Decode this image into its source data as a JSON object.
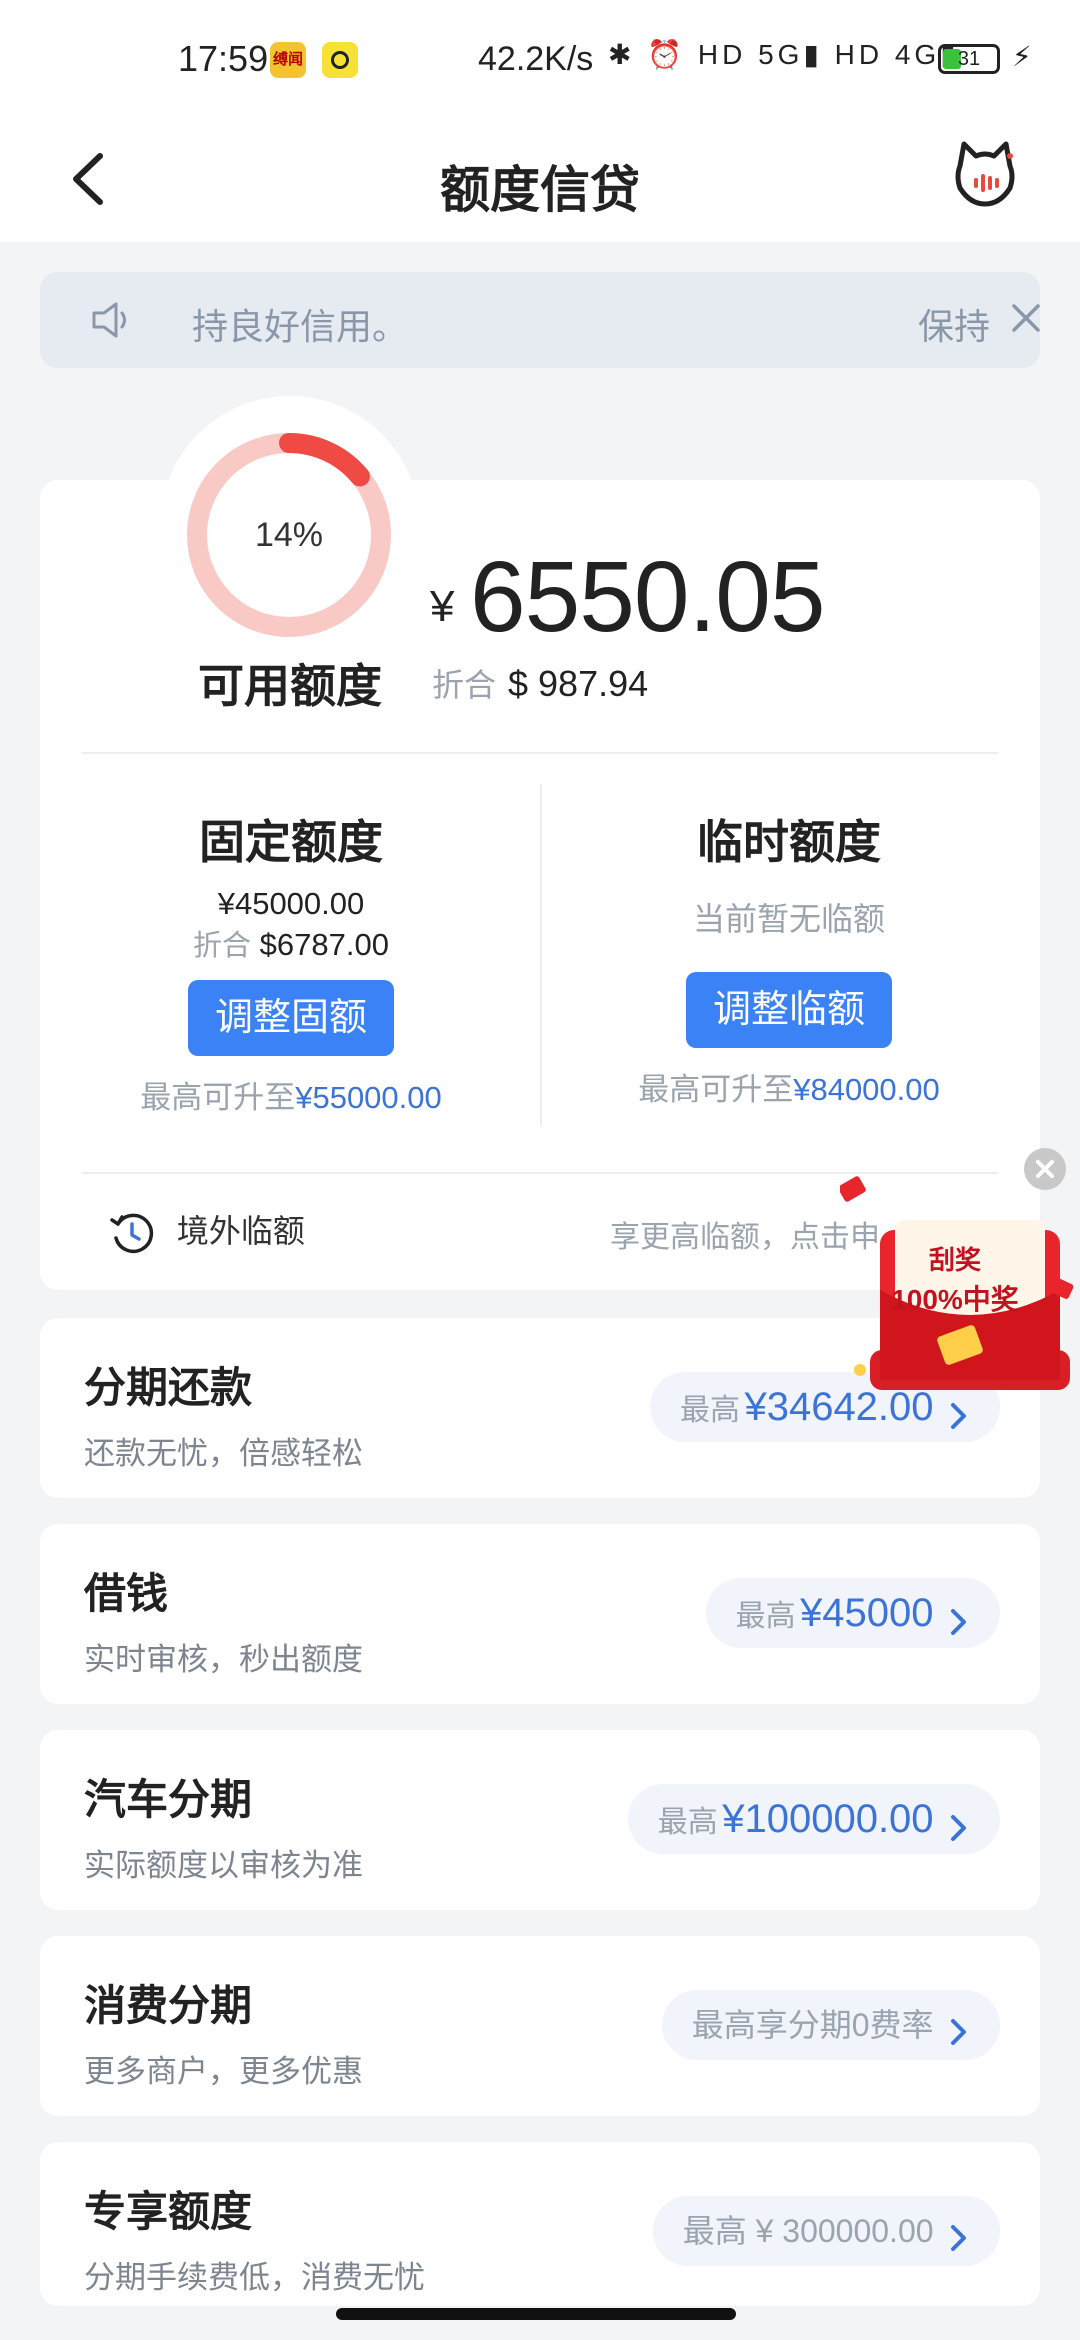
{
  "status_bar": {
    "time": "17:59",
    "app_badge_1": "缚闻",
    "network_speed": "42.2K/s",
    "signal_icons": "✱ ⏰ HD 5G▮ HD 4G▮",
    "battery_level": "31"
  },
  "nav": {
    "title": "额度信贷"
  },
  "notice": {
    "text_part1": "持良好信用。",
    "text_part2": "保持"
  },
  "summary": {
    "usage_percent_label": "14%",
    "usage_fraction": 0.14,
    "available_label": "可用额度",
    "currency_symbol": "¥",
    "available_amount": "6550.05",
    "convert_prefix": "折合",
    "convert_amount": "$ 987.94"
  },
  "fixed": {
    "title": "固定额度",
    "amount": "¥45000.00",
    "convert_prefix": "折合",
    "convert_amount": "$6787.00",
    "button": "调整固额",
    "max_prefix": "最高可升至",
    "max_value": "¥55000.00"
  },
  "temp": {
    "title": "临时额度",
    "status": "当前暂无临额",
    "button": "调整临额",
    "max_prefix": "最高可升至",
    "max_value": "¥84000.00"
  },
  "overseas": {
    "label": "境外临额",
    "hint": "享更高临额，点击申"
  },
  "rows": [
    {
      "title": "分期还款",
      "sub": "还款无忧，倍感轻松",
      "pill_prefix": "最高",
      "pill_value": "¥34642.00"
    },
    {
      "title": "借钱",
      "sub": "实时审核，秒出额度",
      "pill_prefix": "最高",
      "pill_value": "¥45000"
    },
    {
      "title": "汽车分期",
      "sub": "实际额度以审核为准",
      "pill_prefix": "最高",
      "pill_value": "¥100000.00"
    },
    {
      "title": "消费分期",
      "sub": "更多商户，更多优惠",
      "pill_prefix": "",
      "pill_value": "最高享分期0费率"
    },
    {
      "title": "专享额度",
      "sub": "分期手续费低，消费无忧",
      "pill_prefix": "",
      "pill_value": "最高 ¥ 300000.00"
    }
  ],
  "float_widget": {
    "line1": "刮奖",
    "line2": "100%中奖"
  },
  "colors": {
    "accent_blue": "#3b82f6",
    "link_blue": "#3b74d6",
    "ring_red": "#ef4b44",
    "ring_pink": "#f9c9c6",
    "background": "#f3f4f6"
  }
}
